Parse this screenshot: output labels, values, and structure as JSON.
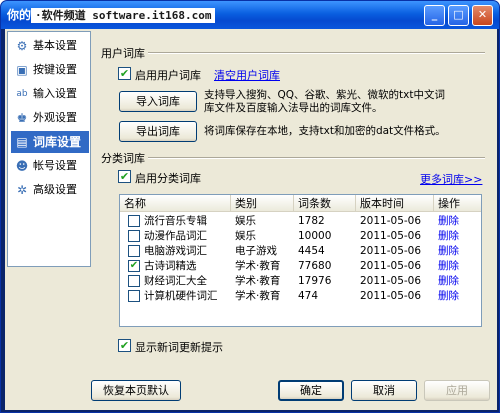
{
  "window": {
    "title": "你的",
    "watermark": "·软件频道 software.it168.com"
  },
  "sidebar": {
    "items": [
      {
        "label": "基本设置",
        "icon": "gear-icon",
        "glyph": "⚙"
      },
      {
        "label": "按键设置",
        "icon": "keyboard-icon",
        "glyph": "▣"
      },
      {
        "label": "输入设置",
        "icon": "input-icon",
        "glyph": "ab"
      },
      {
        "label": "外观设置",
        "icon": "shirt-icon",
        "glyph": "♚"
      },
      {
        "label": "词库设置",
        "icon": "book-icon",
        "glyph": "▤"
      },
      {
        "label": "帐号设置",
        "icon": "user-icon",
        "glyph": "☻"
      },
      {
        "label": "高级设置",
        "icon": "advanced-gear-icon",
        "glyph": "✲"
      }
    ]
  },
  "user_lexicon": {
    "section_title": "用户词库",
    "enable_label": "启用用户词库",
    "enable_checked": true,
    "clear_link": "清空用户词库",
    "import_button": "导入词库",
    "import_desc_1": "支持导入搜狗、QQ、谷歌、紫光、微软的txt中文词",
    "import_desc_2": "库文件及百度输入法导出的词库文件。",
    "export_button": "导出词库",
    "export_desc": "将词库保存在本地，支持txt和加密的dat文件格式。"
  },
  "category_lexicon": {
    "section_title": "分类词库",
    "enable_label": "启用分类词库",
    "enable_checked": true,
    "more_link": "更多词库>>",
    "columns": [
      "名称",
      "类别",
      "词条数",
      "版本时间",
      "操作"
    ],
    "rows": [
      {
        "checked": false,
        "name": "流行音乐专辑",
        "category": "娱乐",
        "count": "1782",
        "date": "2011-05-06",
        "action": "删除"
      },
      {
        "checked": false,
        "name": "动漫作品词汇",
        "category": "娱乐",
        "count": "10000",
        "date": "2011-05-06",
        "action": "删除"
      },
      {
        "checked": false,
        "name": "电脑游戏词汇",
        "category": "电子游戏",
        "count": "4454",
        "date": "2011-05-06",
        "action": "删除"
      },
      {
        "checked": true,
        "name": "古诗词精选",
        "category": "学术·教育",
        "count": "77680",
        "date": "2011-05-06",
        "action": "删除"
      },
      {
        "checked": false,
        "name": "财经词汇大全",
        "category": "学术·教育",
        "count": "17976",
        "date": "2011-05-06",
        "action": "删除"
      },
      {
        "checked": false,
        "name": "计算机硬件词汇",
        "category": "学术·教育",
        "count": "474",
        "date": "2011-05-06",
        "action": "删除"
      }
    ],
    "show_update_label": "显示新词更新提示",
    "show_update_checked": true
  },
  "footer": {
    "restore_button": "恢复本页默认",
    "ok_button": "确定",
    "cancel_button": "取消",
    "apply_button": "应用"
  },
  "colors": {
    "titlebar": "#0a56dc",
    "selection": "#316ac5",
    "link": "#0000ee",
    "dialog_bg": "#ece9d8"
  }
}
